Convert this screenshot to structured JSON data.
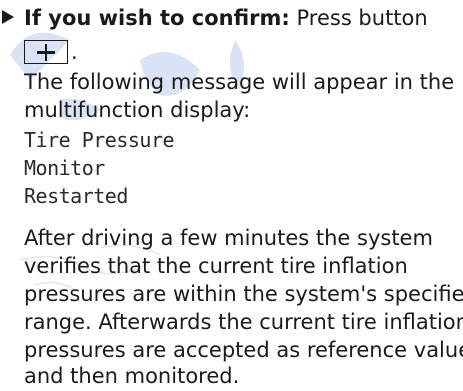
{
  "instruction": {
    "bold_lead": "If you wish to confirm:",
    "text": " Press button",
    "button_symbol": "+",
    "end_punct": "."
  },
  "message_intro": {
    "line1": "The following message will appear in the",
    "line2": "multifunction display:"
  },
  "display_message": {
    "line1": "Tire Pressure",
    "line2": "Monitor",
    "line3": "Restarted"
  },
  "body_text": {
    "line1": "After driving a few minutes the system",
    "line2": "verifies that the current tire inflation",
    "line3": "pressures are within the system's specified",
    "line4": "range. Afterwards the current tire inflation",
    "line5": "pressures are accepted as reference values",
    "line6": "and then monitored."
  },
  "colors": {
    "text": "#1a1a1a",
    "watermark": "#5b7fd6"
  }
}
